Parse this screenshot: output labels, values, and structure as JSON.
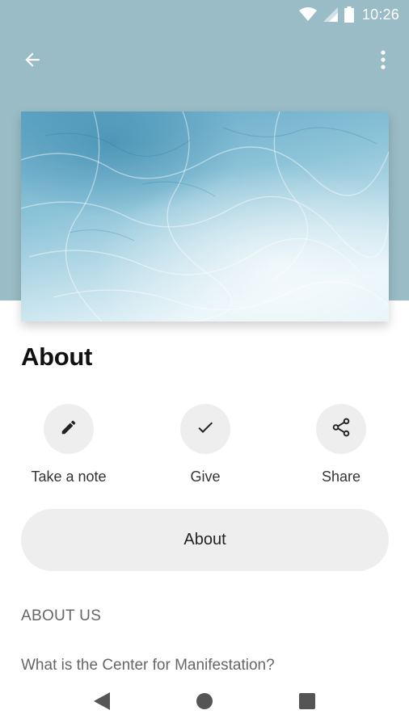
{
  "status_bar": {
    "time": "10:26",
    "icons": [
      "wifi-icon",
      "cell-signal-icon",
      "battery-icon"
    ]
  },
  "toolbar": {
    "back_icon": "arrow-left-icon",
    "more_icon": "more-vertical-icon"
  },
  "page": {
    "title": "About"
  },
  "actions": [
    {
      "label": "Take a note",
      "icon": "pencil-icon"
    },
    {
      "label": "Give",
      "icon": "checkmark-icon"
    },
    {
      "label": "Share",
      "icon": "share-icon"
    }
  ],
  "about_button": {
    "label": "About"
  },
  "content": {
    "section_header": "ABOUT US",
    "question": "What is the Center for Manifestation?"
  },
  "nav_bar": {
    "icons": [
      "back-triangle-icon",
      "home-circle-icon",
      "recents-square-icon"
    ]
  },
  "colors": {
    "header_background": "#99bcc6",
    "circle_background": "#eeeeee",
    "pill_background": "#eeeeee"
  }
}
